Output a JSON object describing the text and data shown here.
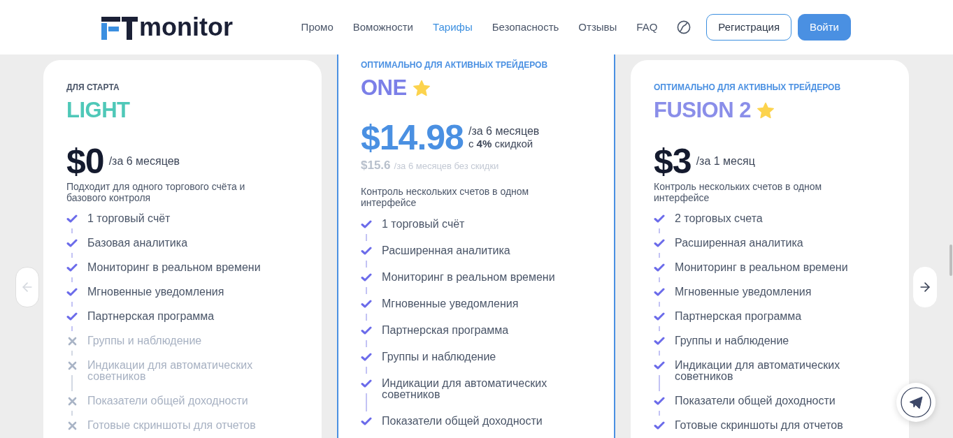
{
  "header": {
    "logo_text": "monitor",
    "nav": [
      {
        "label": "Промо",
        "selected": false
      },
      {
        "label": "Воможности",
        "selected": false
      },
      {
        "label": "Тарифы",
        "selected": true
      },
      {
        "label": "Безопасность",
        "selected": false
      },
      {
        "label": "Отзывы",
        "selected": false
      },
      {
        "label": "FAQ",
        "selected": false
      }
    ],
    "buttons": [
      {
        "label": "Регистрация",
        "kind": "outline"
      },
      {
        "label": "Войти",
        "kind": "filled"
      }
    ]
  },
  "carousel_arrows": [
    {
      "kind": "prev",
      "disabled": true
    },
    {
      "kind": "next",
      "disabled": false
    }
  ],
  "plans": [
    {
      "kind": "basic",
      "featured": false,
      "tagline": "ДЛЯ СТАРТА",
      "name": "LIGHT",
      "color": "#4fc8b8",
      "price": "$0",
      "period": "/за 6 месяцев",
      "description": "Подходит для одного торгового счёта и базового контроля",
      "features": [
        {
          "text": "1 торговый счёт",
          "included": true
        },
        {
          "text": "Базовая аналитика",
          "included": true
        },
        {
          "text": "Мониторинг в реальном времени",
          "included": true
        },
        {
          "text": "Мгновенные уведомления",
          "included": true
        },
        {
          "text": "Партнерская программа",
          "included": true
        },
        {
          "text": "Группы и наблюдение",
          "included": false
        },
        {
          "text": "Индикации для автоматических советников",
          "included": false
        },
        {
          "text": "Показатели общей доходности",
          "included": false
        },
        {
          "text": "Готовые скриншоты для отчетов",
          "included": false
        }
      ]
    },
    {
      "kind": "pro",
      "featured": true,
      "tagline": "ОПТИМАЛЬНО ДЛЯ АКТИВНЫХ ТРЕЙДЕРОВ",
      "name": "ONE",
      "color": "#7b7fe8",
      "price": "$14.98",
      "period": "/за 6 месяцев",
      "discount": "с **4%** скидкой",
      "old_price": "$15.6",
      "old_period": "/за 6 месяцев без скидки",
      "description": "Контроль нескольких счетов в одном интерфейсе",
      "features": [
        {
          "text": "1 торговый счёт",
          "included": true
        },
        {
          "text": "Расширенная аналитика",
          "included": true
        },
        {
          "text": "Мониторинг в реальном времени",
          "included": true
        },
        {
          "text": "Мгновенные уведомления",
          "included": true
        },
        {
          "text": "Партнерская программа",
          "included": true
        },
        {
          "text": "Группы и наблюдение",
          "included": true
        },
        {
          "text": "Индикации для автоматических советников",
          "included": true
        },
        {
          "text": "Показатели общей доходности",
          "included": true
        }
      ]
    },
    {
      "kind": "pro",
      "featured": false,
      "tagline": "ОПТИМАЛЬНО ДЛЯ АКТИВНЫХ ТРЕЙДЕРОВ",
      "name": "FUSION 2",
      "color": "#8a8ee9",
      "price": "$3",
      "period": "/за 1 месяц",
      "description": "Контроль нескольких счетов в одном интерфейсе",
      "features": [
        {
          "text": "2 торговых счета",
          "included": true
        },
        {
          "text": "Расширенная аналитика",
          "included": true
        },
        {
          "text": "Мониторинг в реальном времени",
          "included": true
        },
        {
          "text": "Мгновенные уведомления",
          "included": true
        },
        {
          "text": "Партнерская программа",
          "included": true
        },
        {
          "text": "Группы и наблюдение",
          "included": true
        },
        {
          "text": "Индикации для автоматических советников",
          "included": true
        },
        {
          "text": "Показатели общей доходности",
          "included": true
        },
        {
          "text": "Готовые скриншоты для отчетов",
          "included": true
        }
      ]
    }
  ]
}
